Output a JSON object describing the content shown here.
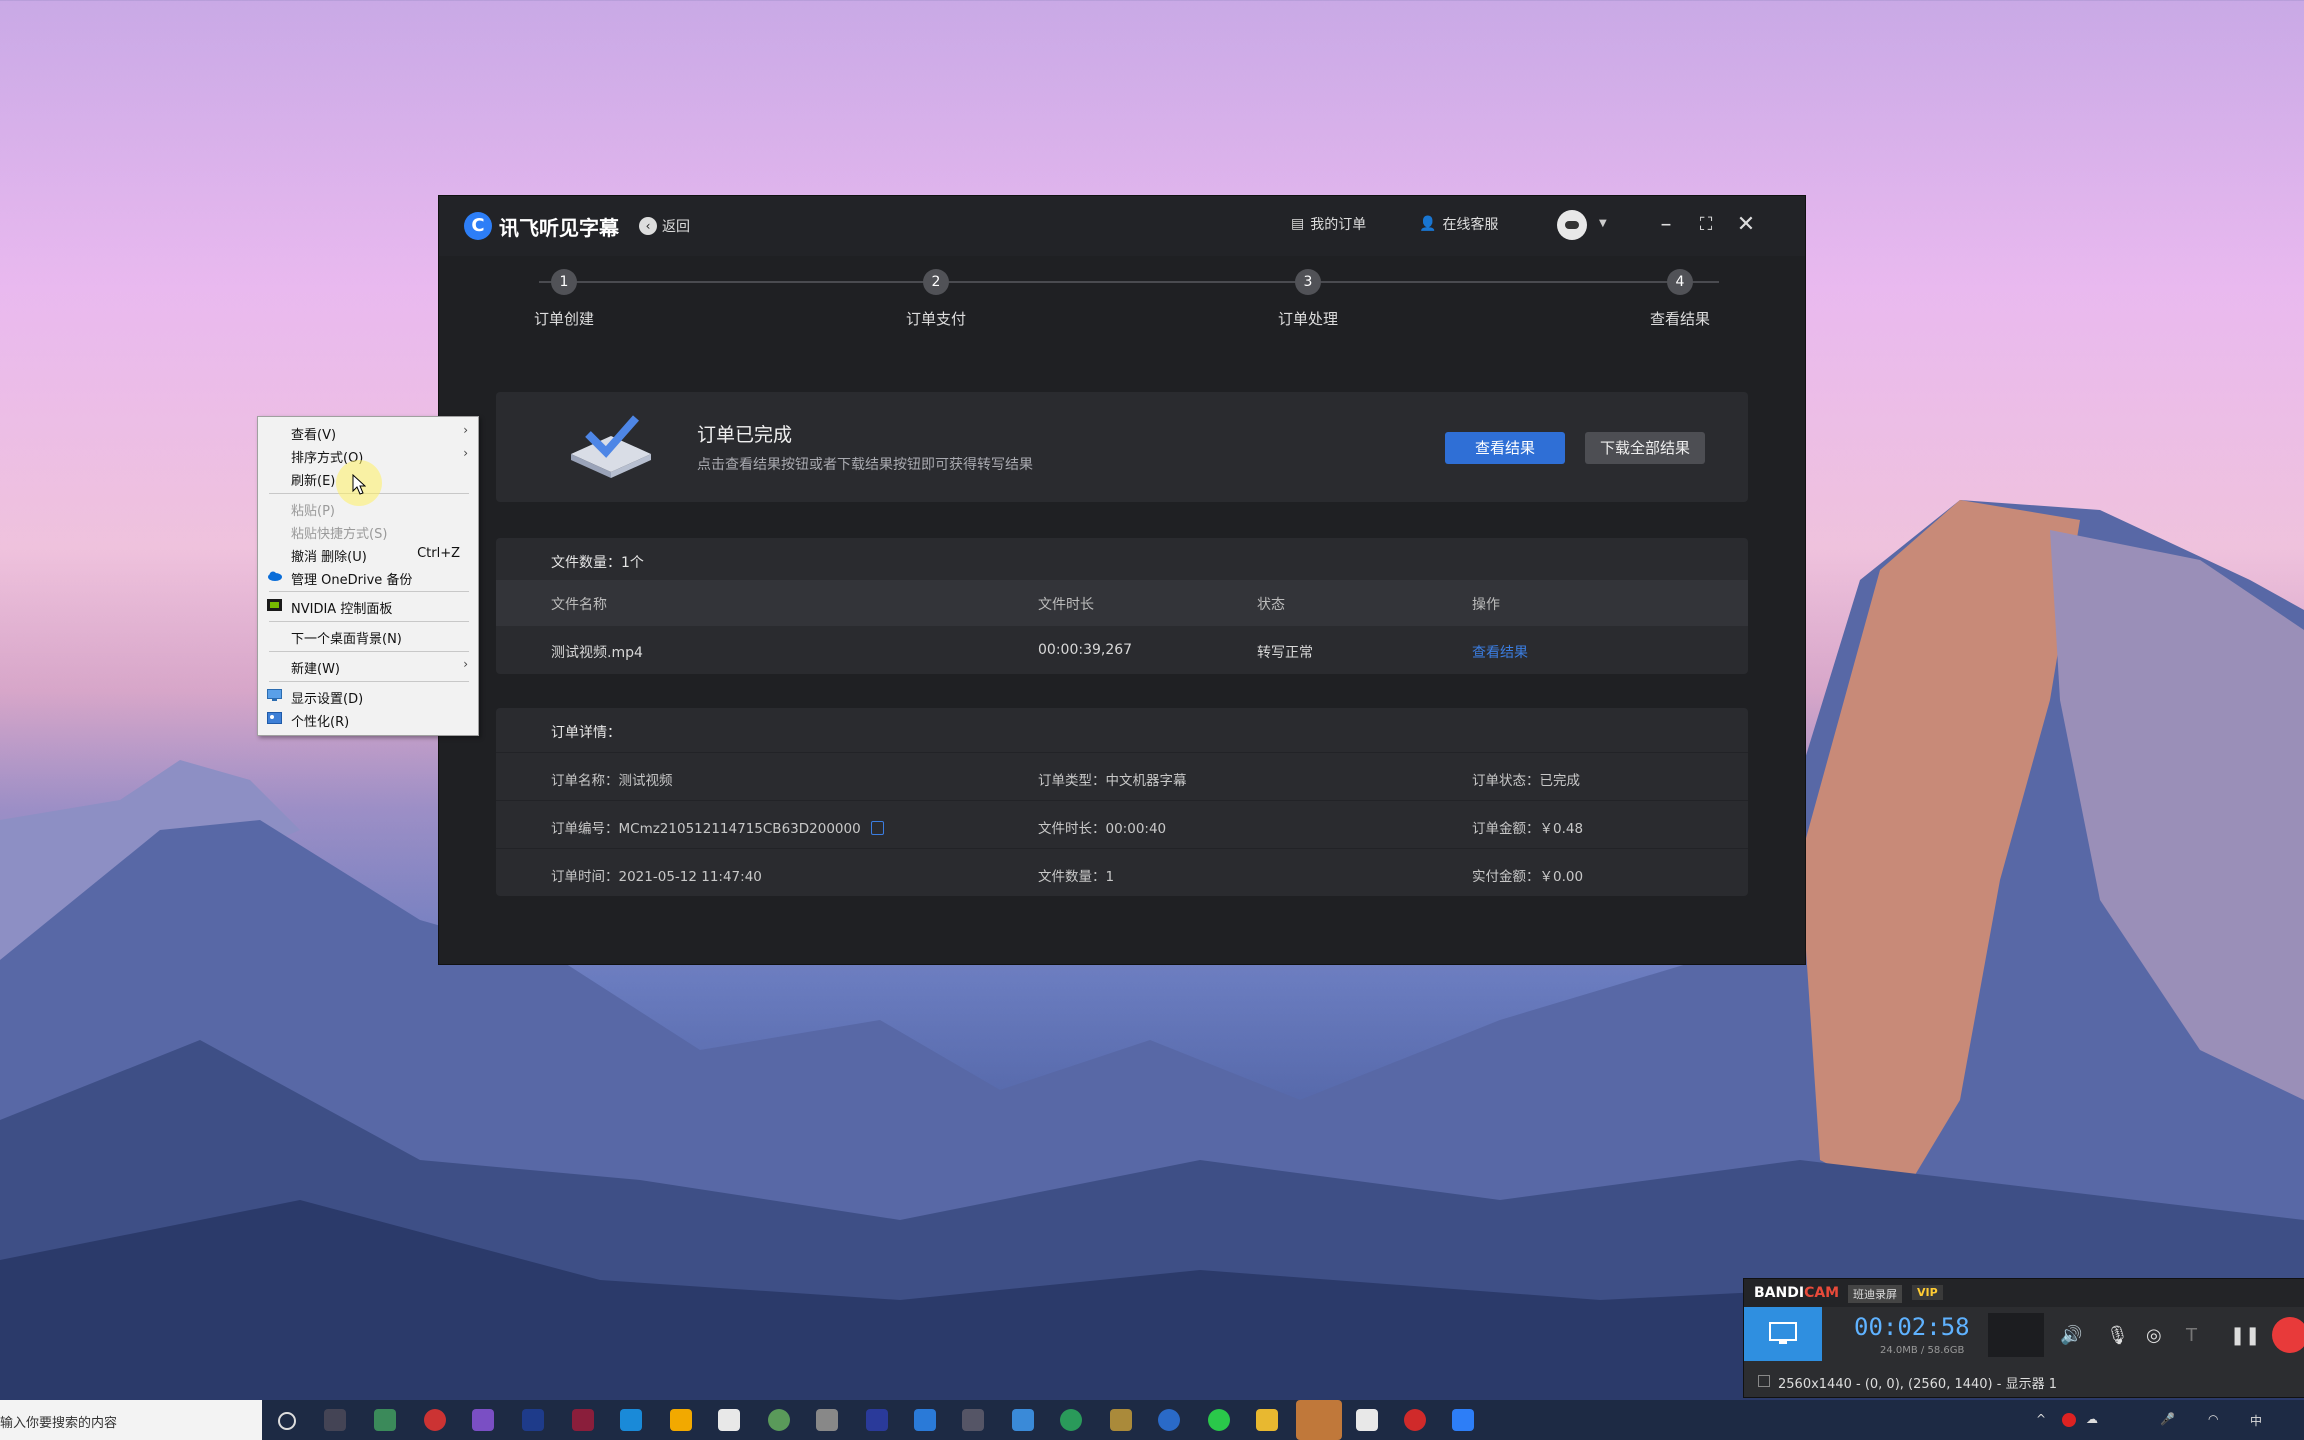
{
  "app": {
    "title": "讯飞听见字幕",
    "back_label": "返回",
    "my_orders": "我的订单",
    "support": "在线客服"
  },
  "steps": [
    {
      "num": "1",
      "label": "订单创建"
    },
    {
      "num": "2",
      "label": "订单支付"
    },
    {
      "num": "3",
      "label": "订单处理"
    },
    {
      "num": "4",
      "label": "查看结果"
    }
  ],
  "status_card": {
    "title": "订单已完成",
    "subtitle": "点击查看结果按钮或者下载结果按钮即可获得转写结果",
    "view_button": "查看结果",
    "download_button": "下载全部结果"
  },
  "files": {
    "count_label": "文件数量：1个",
    "columns": [
      "文件名称",
      "文件时长",
      "状态",
      "操作"
    ],
    "rows": [
      {
        "name": "测试视频.mp4",
        "duration": "00:00:39,267",
        "status": "转写正常",
        "action": "查看结果"
      }
    ]
  },
  "details": {
    "title": "订单详情：",
    "rows": [
      [
        "订单名称：测试视频",
        "订单类型：中文机器字幕",
        "订单状态：已完成"
      ],
      [
        "订单编号：MCmz210512114715CB63D200000",
        "文件时长：00:00:40",
        "订单金额：￥0.48"
      ],
      [
        "订单时间：2021-05-12 11:47:40",
        "文件数量：1",
        "实付金额：￥0.00"
      ]
    ]
  },
  "context_menu": {
    "items": [
      {
        "label": "查看(V)",
        "submenu": true,
        "disabled": false
      },
      {
        "label": "排序方式(O)",
        "submenu": true,
        "disabled": false
      },
      {
        "label": "刷新(E)",
        "submenu": false,
        "disabled": false
      },
      {
        "label": "粘贴(P)",
        "submenu": false,
        "disabled": true
      },
      {
        "label": "粘贴快捷方式(S)",
        "submenu": false,
        "disabled": true
      },
      {
        "label": "撤消 删除(U)",
        "shortcut": "Ctrl+Z",
        "disabled": false
      },
      {
        "label": "管理 OneDrive 备份",
        "icon": "cloud-icon",
        "disabled": false
      },
      {
        "label": "NVIDIA 控制面板",
        "icon": "nvidia-icon",
        "disabled": false
      },
      {
        "label": "下一个桌面背景(N)",
        "disabled": false
      },
      {
        "label": "新建(W)",
        "submenu": true,
        "disabled": false
      },
      {
        "label": "显示设置(D)",
        "icon": "display-icon",
        "disabled": false
      },
      {
        "label": "个性化(R)",
        "icon": "personalize-icon",
        "disabled": false
      }
    ]
  },
  "bandicam": {
    "brand_a": "BANDI",
    "brand_b": "CAM",
    "tag": "班迪录屏",
    "vip": "VIP",
    "timer": "00:02:58",
    "size": "24.0MB / 58.6GB",
    "status": "2560x1440 - (0, 0), (2560, 1440) - 显示器 1"
  },
  "taskbar": {
    "search_placeholder": "输入你要搜索的内容",
    "tray_ime": "中"
  },
  "colors": {
    "accent": "#2f6fd6",
    "link": "#3b7de0",
    "window_bg": "#1f2023"
  }
}
